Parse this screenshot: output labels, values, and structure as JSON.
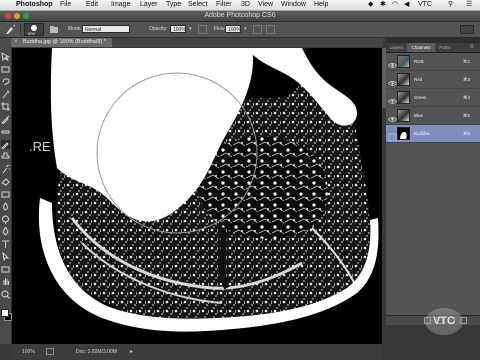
{
  "menubar": {
    "app_name": "Photoshop",
    "items": [
      "File",
      "Edit",
      "Image",
      "Layer",
      "Type",
      "Select",
      "Filter",
      "3D",
      "View",
      "Window",
      "Help"
    ],
    "user": "VTC"
  },
  "window": {
    "title": "Adobe Photoshop CS6"
  },
  "options": {
    "brush_size": "500",
    "mode_label": "Mode:",
    "mode_value": "Normal",
    "opacity_label": "Opacity:",
    "opacity_value": "100%",
    "flow_label": "Flow:",
    "flow_value": "100%"
  },
  "document": {
    "tab_label": "Buddha.jpg @ 100% (Buddha/8) *"
  },
  "tools": [
    "move-tool-icon",
    "marquee-tool-icon",
    "lasso-tool-icon",
    "quick-select-tool-icon",
    "crop-tool-icon",
    "eyedropper-tool-icon",
    "healing-brush-tool-icon",
    "brush-tool-icon",
    "clone-stamp-tool-icon",
    "history-brush-tool-icon",
    "eraser-tool-icon",
    "gradient-tool-icon",
    "blur-tool-icon",
    "dodge-tool-icon",
    "pen-tool-icon",
    "type-tool-icon",
    "path-select-tool-icon",
    "rectangle-tool-icon",
    "hand-tool-icon",
    "zoom-tool-icon"
  ],
  "canvas": {
    "stray_text": ".RE"
  },
  "status": {
    "zoom": "100%",
    "doc_info": "Doc: 3.82M/3.00M"
  },
  "panels": {
    "tabs": [
      "Layers",
      "Channels",
      "Paths"
    ],
    "active_tab": "Channels",
    "channels": [
      {
        "name": "RGB",
        "shortcut": "⌘2",
        "thumb": "color"
      },
      {
        "name": "Red",
        "shortcut": "⌘3",
        "thumb": "gray"
      },
      {
        "name": "Green",
        "shortcut": "⌘4",
        "thumb": "gray"
      },
      {
        "name": "Blue",
        "shortcut": "⌘5",
        "thumb": "gray"
      },
      {
        "name": "Buddha",
        "shortcut": "⌘6",
        "thumb": "mask",
        "selected": true
      }
    ]
  },
  "watermark": "VTC",
  "colors": {
    "selected_channel": "#7e8ec1",
    "panel_bg": "#535353",
    "canvas_bg": "#000000"
  }
}
